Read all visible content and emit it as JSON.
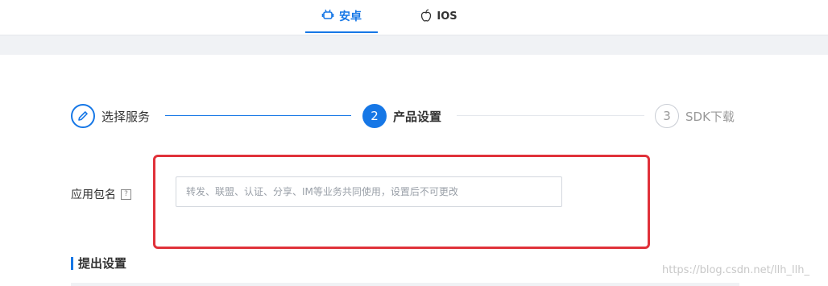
{
  "tabs": [
    {
      "label": "安卓",
      "icon": "android-icon",
      "active": true
    },
    {
      "label": "IOS",
      "icon": "apple-icon",
      "active": false
    }
  ],
  "steps": [
    {
      "label": "选择服务",
      "marker": "edit-icon",
      "state": "done"
    },
    {
      "label": "产品设置",
      "marker": "2",
      "state": "active"
    },
    {
      "label": "SDK下载",
      "marker": "3",
      "state": "pending"
    }
  ],
  "form": {
    "package_label": "应用包名",
    "help_symbol": "?",
    "package_placeholder": "转发、联盟、认证、分享、IM等业务共同使用，设置后不可更改",
    "package_value": ""
  },
  "section": {
    "title": "提出设置"
  },
  "watermark": "https://blog.csdn.net/llh_llh_",
  "colors": {
    "accent": "#1677e6",
    "annotation_box": "#e0313a"
  }
}
